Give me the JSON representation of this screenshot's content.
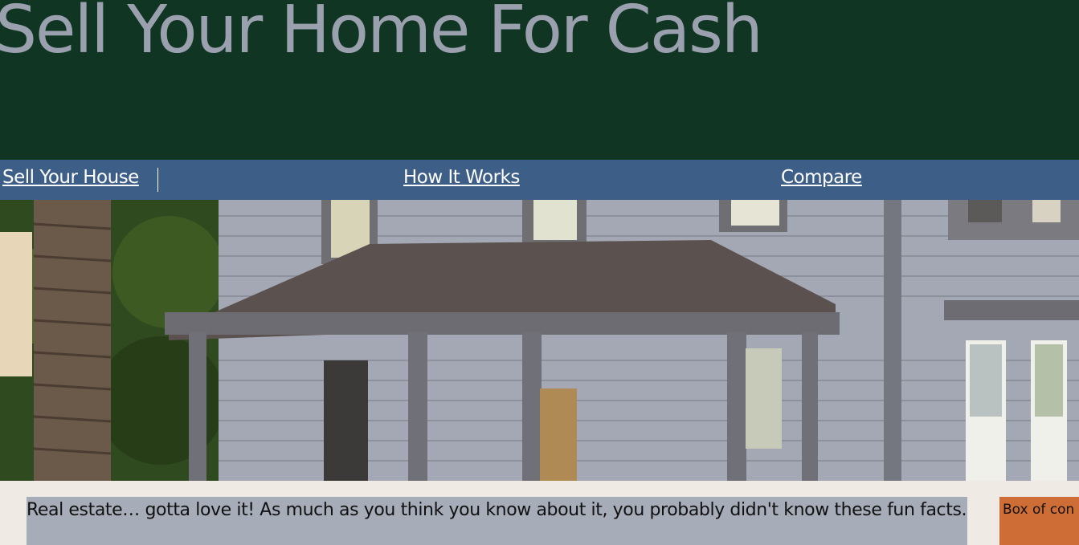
{
  "header": {
    "title": "Sell Your Home For Cash"
  },
  "nav": {
    "items": [
      {
        "label": "Sell Your House"
      },
      {
        "label": "How It Works"
      },
      {
        "label": "Compare"
      }
    ]
  },
  "main": {
    "intro_text": "Real estate… gotta love it! As much as you think you know about it, you probably didn't know these fun facts."
  },
  "sidebar": {
    "box_text": "Box of con"
  },
  "colors": {
    "header_bg": "#103522",
    "title_text": "#9aa0ad",
    "nav_bg": "#3d5e87",
    "page_bg": "#efeae3",
    "content_box_bg": "#a6acb8",
    "side_box_bg": "#cf6d36"
  }
}
